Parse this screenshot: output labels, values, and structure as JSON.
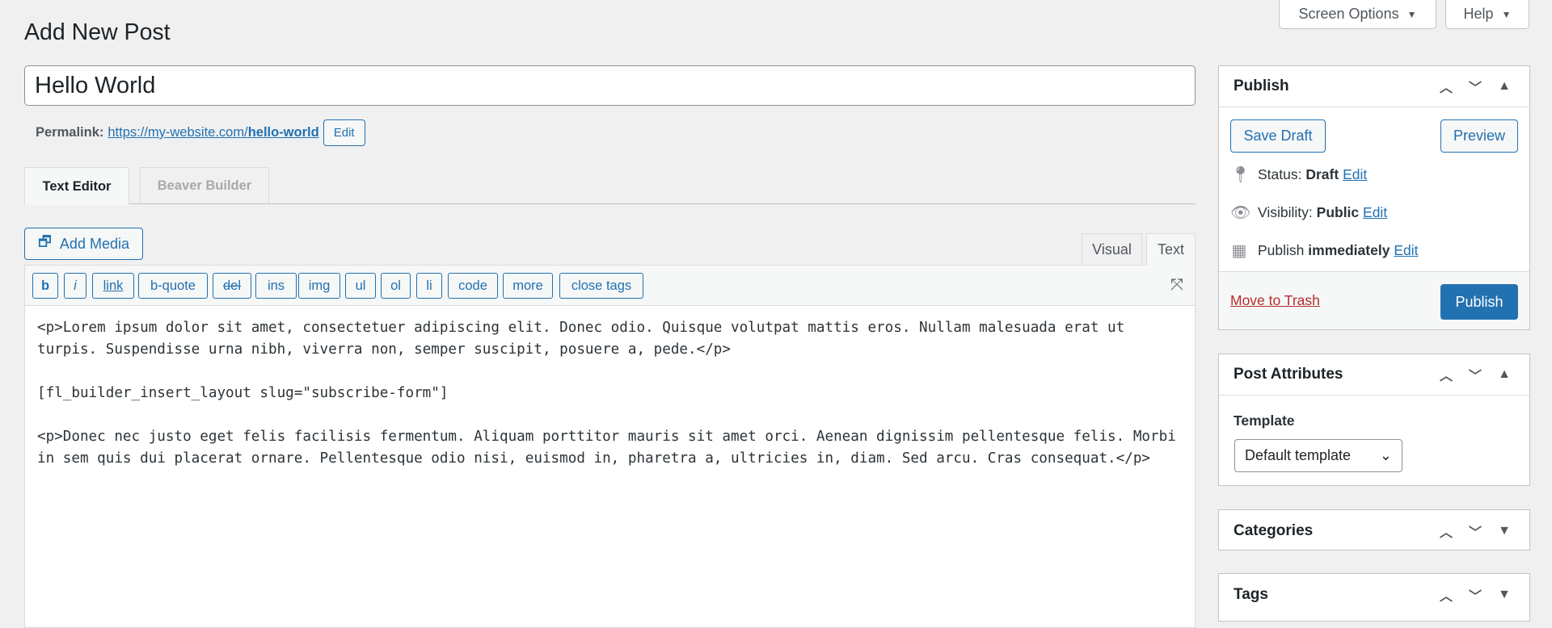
{
  "header": {
    "screen_options": "Screen Options",
    "help": "Help",
    "title": "Add New Post"
  },
  "post": {
    "title": "Hello World",
    "permalink_label": "Permalink:",
    "permalink_base": "https://my-website.com/",
    "permalink_slug": "hello-world",
    "edit": "Edit"
  },
  "tabs": [
    {
      "label": "Text Editor",
      "active": true
    },
    {
      "label": "Beaver Builder",
      "active": false
    }
  ],
  "editor": {
    "add_media": "Add Media",
    "mode_tabs": [
      "Visual",
      "Text"
    ],
    "active_mode": "Text",
    "quicktags": [
      "b",
      "i",
      "link",
      "b-quote",
      "del",
      "ins",
      "img",
      "ul",
      "ol",
      "li",
      "code",
      "more",
      "close tags"
    ],
    "content": "<p>Lorem ipsum dolor sit amet, consectetuer adipiscing elit. Donec odio. Quisque volutpat mattis eros. Nullam malesuada erat ut turpis. Suspendisse urna nibh, viverra non, semper suscipit, posuere a, pede.</p>\n\n[fl_builder_insert_layout slug=\"subscribe-form\"]\n\n<p>Donec nec justo eget felis facilisis fermentum. Aliquam porttitor mauris sit amet orci. Aenean dignissim pellentesque felis. Morbi in sem quis dui placerat ornare. Pellentesque odio nisi, euismod in, pharetra a, ultricies in, diam. Sed arcu. Cras consequat.</p>"
  },
  "publish": {
    "title": "Publish",
    "save_draft": "Save Draft",
    "preview": "Preview",
    "status_label": "Status:",
    "status_value": "Draft",
    "visibility_label": "Visibility:",
    "visibility_value": "Public",
    "schedule_label": "Publish",
    "schedule_value": "immediately",
    "edit": "Edit",
    "trash": "Move to Trash",
    "publish": "Publish"
  },
  "attributes": {
    "title": "Post Attributes",
    "template_label": "Template",
    "template_value": "Default template"
  },
  "categories": {
    "title": "Categories"
  },
  "tags": {
    "title": "Tags"
  },
  "colors": {
    "accent": "#2271b1",
    "trash": "#b32d2e",
    "background": "#f0f0f1"
  }
}
